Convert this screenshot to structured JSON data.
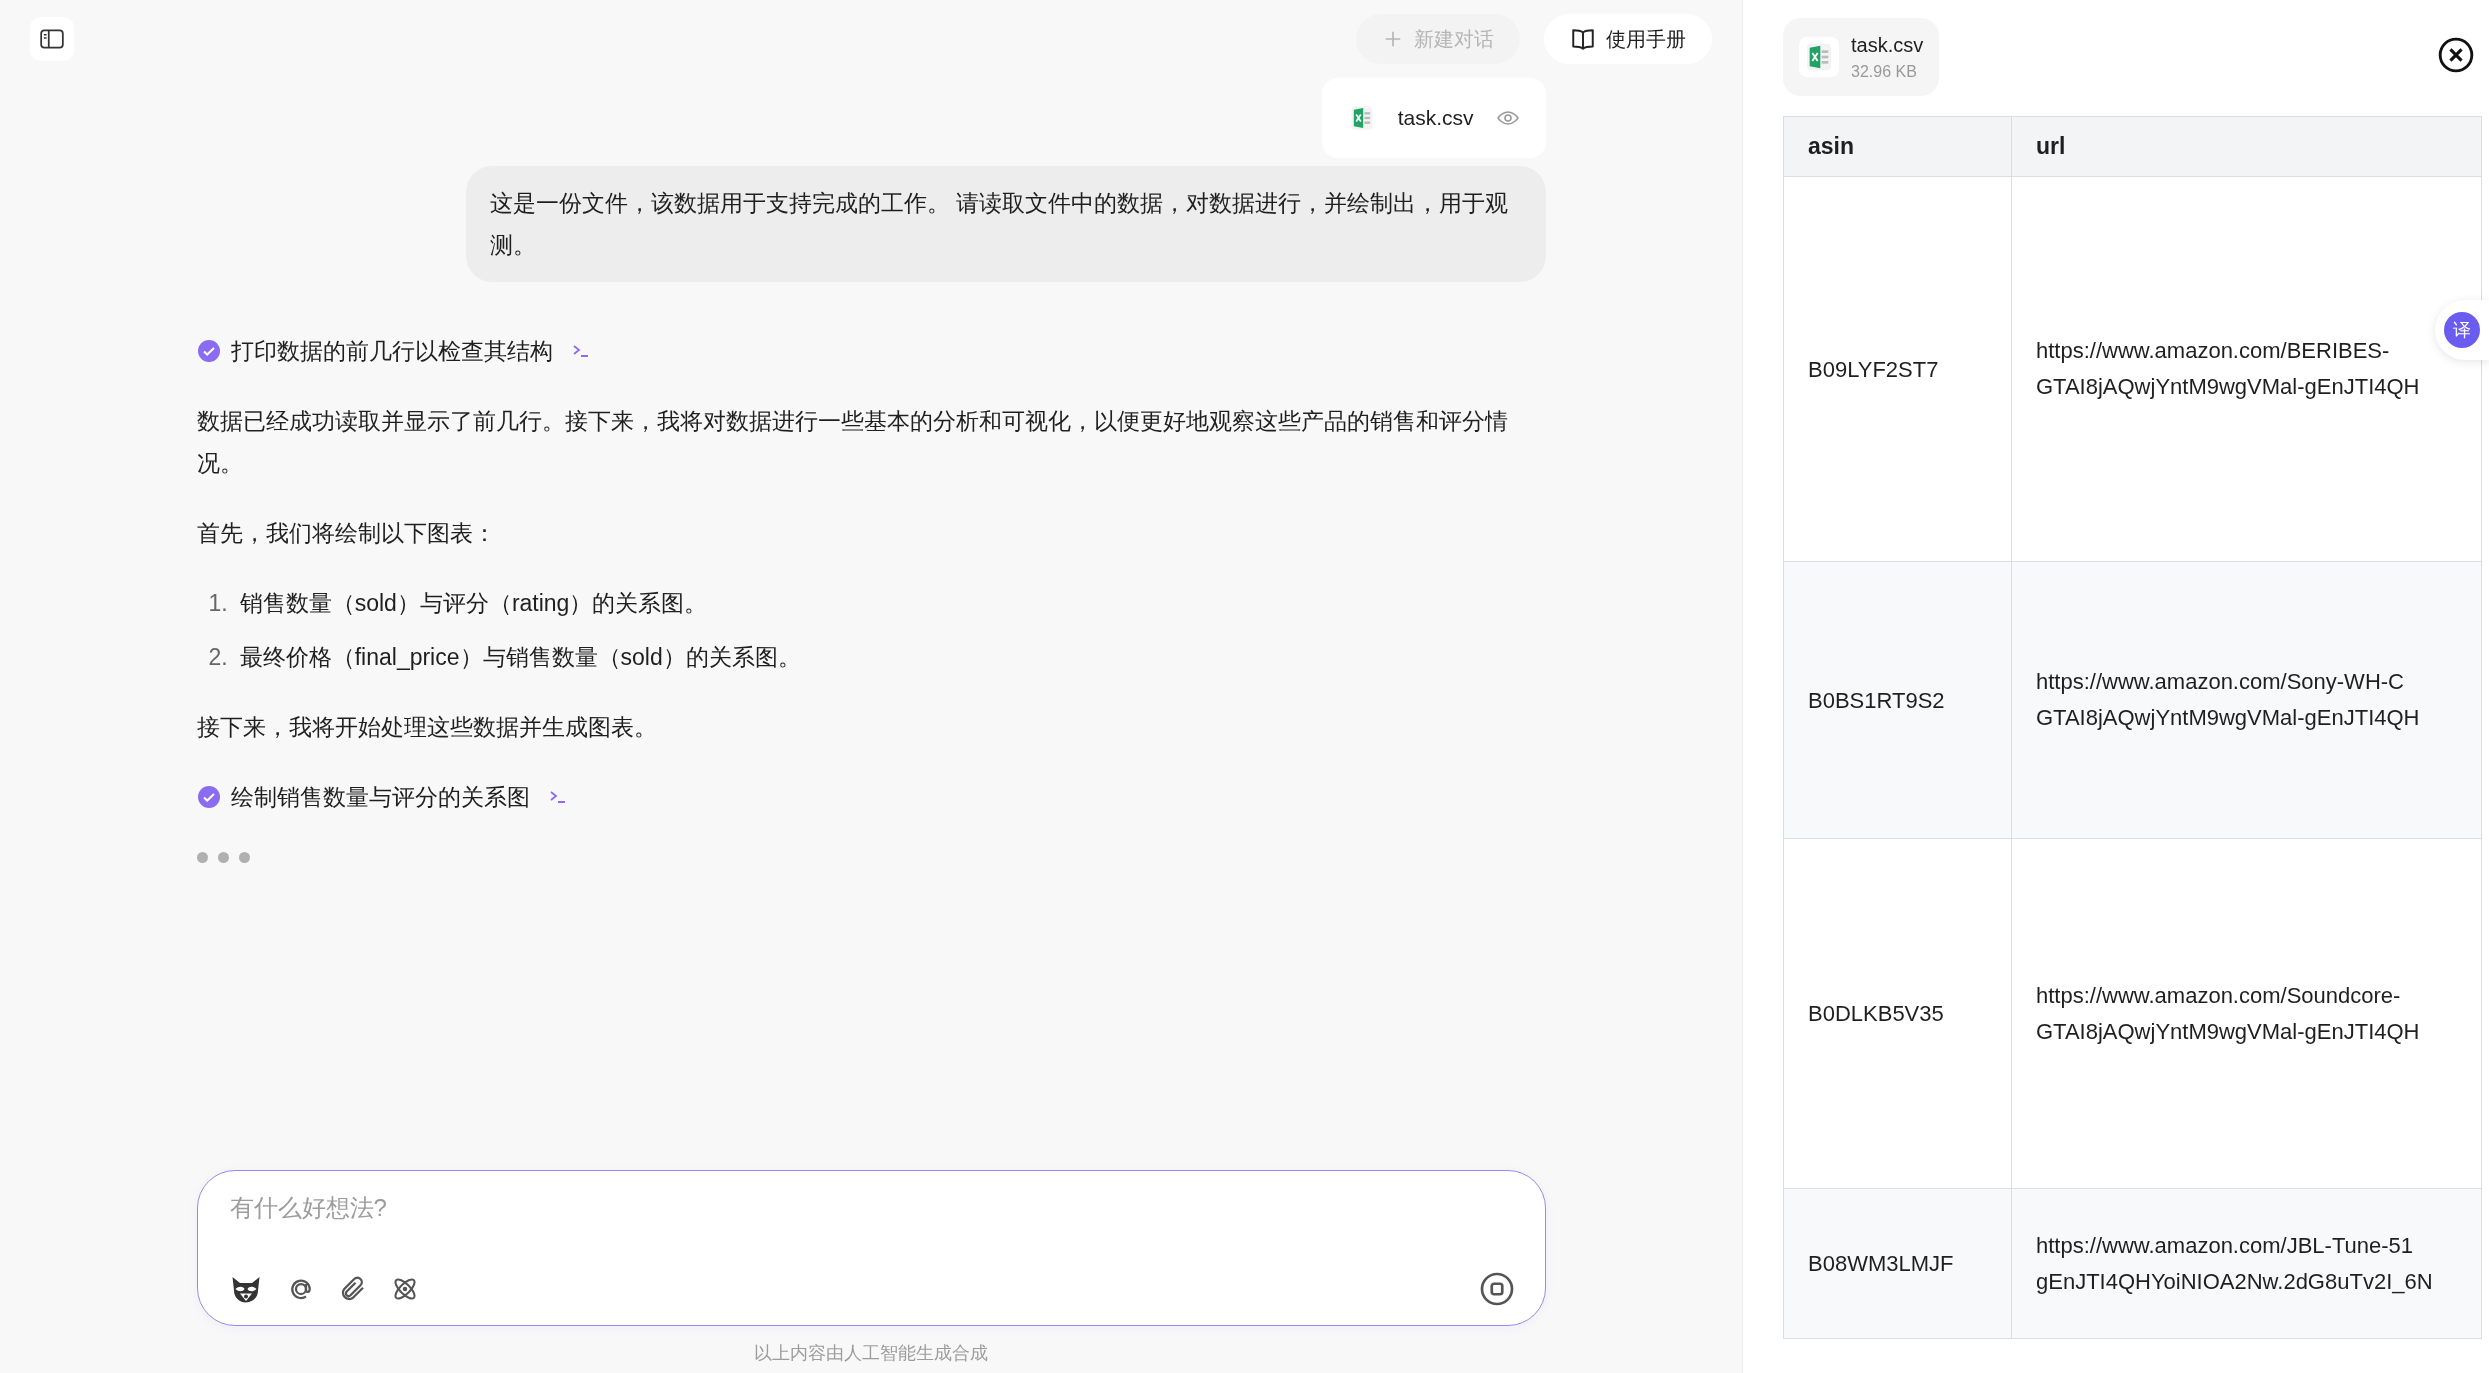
{
  "header": {
    "new_chat": {
      "label": "新建对话",
      "disabled": true
    },
    "manual": {
      "label": "使用手册"
    }
  },
  "attachment": {
    "name": "task.csv"
  },
  "user_message": "这是一份文件，该数据用于支持完成的工作。 请读取文件中的数据，对数据进行，并绘制出，用于观测。",
  "assistant": [
    {
      "kind": "step",
      "text": "打印数据的前几行以检查其结构",
      "done": true
    },
    {
      "kind": "paragraph",
      "text": "数据已经成功读取并显示了前几行。接下来，我将对数据进行一些基本的分析和可视化，以便更好地观察这些产品的销售和评分情况。"
    },
    {
      "kind": "paragraph",
      "text": "首先，我们将绘制以下图表："
    },
    {
      "kind": "list",
      "items": [
        {
          "number": "1.",
          "text": "销售数量（sold）与评分（rating）的关系图。"
        },
        {
          "number": "2.",
          "text": "最终价格（final_price）与销售数量（sold）的关系图。"
        }
      ]
    },
    {
      "kind": "paragraph",
      "text": "接下来，我将开始处理这些数据并生成图表。"
    },
    {
      "kind": "step",
      "text": "绘制销售数量与评分的关系图",
      "done": true
    },
    {
      "kind": "typing"
    }
  ],
  "composer": {
    "placeholder": "有什么好想法?"
  },
  "disclaimer": "以上内容由人工智能生成合成",
  "preview": {
    "file": {
      "name": "task.csv",
      "size": "32.96 KB"
    },
    "table": {
      "columns": [
        "asin",
        "url"
      ],
      "rows": [
        {
          "asin": "B09LYF2ST7",
          "url": [
            "https://www.amazon.com/BERIBES-",
            "GTAI8jAQwjYntM9wgVMal-gEnJTI4QH"
          ]
        },
        {
          "asin": "B0BS1RT9S2",
          "url": [
            "https://www.amazon.com/Sony-WH-C",
            "GTAI8jAQwjYntM9wgVMal-gEnJTI4QH"
          ]
        },
        {
          "asin": "B0DLKB5V35",
          "url": [
            "https://www.amazon.com/Soundcore-",
            "GTAI8jAQwjYntM9wgVMal-gEnJTI4QH"
          ]
        },
        {
          "asin": "B08WM3LMJF",
          "url": [
            "https://www.amazon.com/JBL-Tune-51",
            "gEnJTI4QHYoiNIOA2Nw.2dG8uTv2I_6N"
          ]
        }
      ]
    }
  },
  "translate_button": "译"
}
